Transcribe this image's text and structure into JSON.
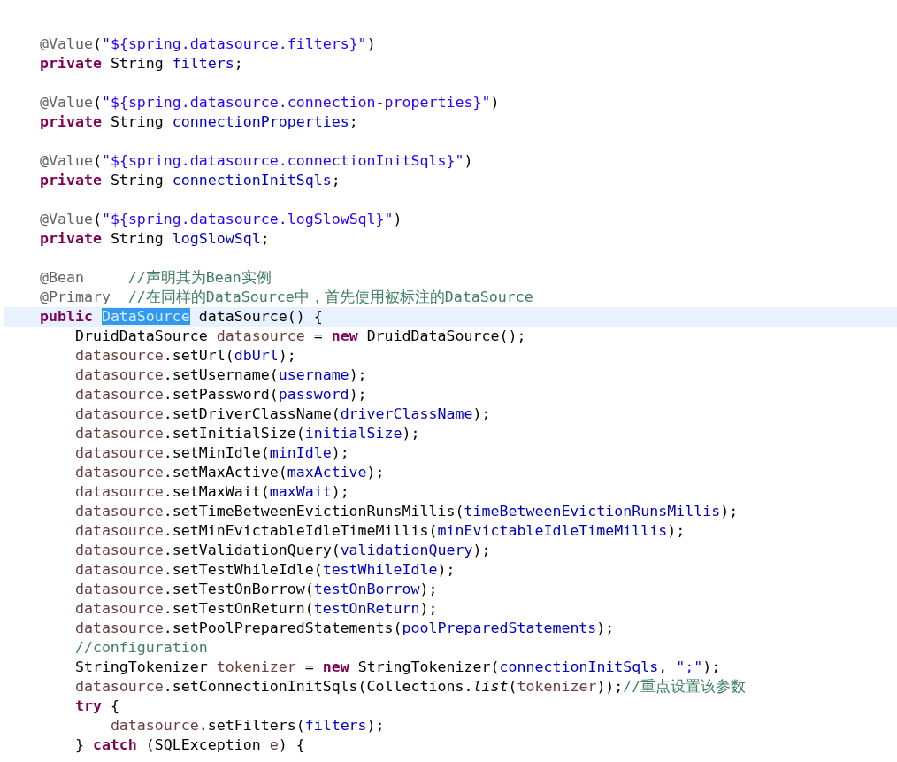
{
  "editor": {
    "lines": [
      {
        "kind": "code",
        "current": false,
        "tokens": [
          {
            "kind": "ann",
            "t": "@Value"
          },
          {
            "kind": "plain",
            "t": "("
          },
          {
            "kind": "str",
            "t": "\"${spring.datasource.filters}\""
          },
          {
            "kind": "plain",
            "t": ")"
          }
        ]
      },
      {
        "kind": "code",
        "current": false,
        "tokens": [
          {
            "kind": "kw",
            "t": "private"
          },
          {
            "kind": "plain",
            "t": " String "
          },
          {
            "kind": "field",
            "t": "filters"
          },
          {
            "kind": "plain",
            "t": ";"
          }
        ]
      },
      {
        "kind": "blank"
      },
      {
        "kind": "code",
        "current": false,
        "tokens": [
          {
            "kind": "ann",
            "t": "@Value"
          },
          {
            "kind": "plain",
            "t": "("
          },
          {
            "kind": "str",
            "t": "\"${spring.datasource.connection-properties}\""
          },
          {
            "kind": "plain",
            "t": ")"
          }
        ]
      },
      {
        "kind": "code",
        "current": false,
        "tokens": [
          {
            "kind": "kw",
            "t": "private"
          },
          {
            "kind": "plain",
            "t": " String "
          },
          {
            "kind": "field",
            "t": "connectionProperties"
          },
          {
            "kind": "plain",
            "t": ";"
          }
        ]
      },
      {
        "kind": "blank"
      },
      {
        "kind": "code",
        "current": false,
        "tokens": [
          {
            "kind": "ann",
            "t": "@Value"
          },
          {
            "kind": "plain",
            "t": "("
          },
          {
            "kind": "str",
            "t": "\"${spring.datasource.connectionInitSqls}\""
          },
          {
            "kind": "plain",
            "t": ")"
          }
        ]
      },
      {
        "kind": "code",
        "current": false,
        "tokens": [
          {
            "kind": "kw",
            "t": "private"
          },
          {
            "kind": "plain",
            "t": " String "
          },
          {
            "kind": "field",
            "t": "connectionInitSqls"
          },
          {
            "kind": "plain",
            "t": ";"
          }
        ]
      },
      {
        "kind": "blank"
      },
      {
        "kind": "code",
        "current": false,
        "tokens": [
          {
            "kind": "ann",
            "t": "@Value"
          },
          {
            "kind": "plain",
            "t": "("
          },
          {
            "kind": "str",
            "t": "\"${spring.datasource.logSlowSql}\""
          },
          {
            "kind": "plain",
            "t": ")"
          }
        ]
      },
      {
        "kind": "code",
        "current": false,
        "tokens": [
          {
            "kind": "kw",
            "t": "private"
          },
          {
            "kind": "plain",
            "t": " String "
          },
          {
            "kind": "field",
            "t": "logSlowSql"
          },
          {
            "kind": "plain",
            "t": ";"
          }
        ]
      },
      {
        "kind": "blank"
      },
      {
        "kind": "code",
        "current": false,
        "tokens": [
          {
            "kind": "ann",
            "t": "@Bean"
          },
          {
            "kind": "comment",
            "t": "//声明其为Bean实例"
          }
        ]
      },
      {
        "kind": "code",
        "current": false,
        "tokens": [
          {
            "kind": "ann",
            "t": "@Primary"
          },
          {
            "kind": "comment",
            "t": "//在同样的DataSource中，首先使用被标注的DataSource"
          }
        ]
      },
      {
        "kind": "code",
        "current": true,
        "tokens": [
          {
            "kind": "kw",
            "t": "public"
          },
          {
            "kind": "sel",
            "t": "DataSource"
          },
          {
            "kind": "plain",
            "t": " dataSource() {"
          }
        ],
        "children": [
          {
            "kind": "code",
            "current": false,
            "tokens": [
              {
                "kind": "plain",
                "t": "DruidDataSource "
              },
              {
                "kind": "local",
                "t": "datasource"
              },
              {
                "kind": "plain",
                "t": " = "
              },
              {
                "kind": "kw",
                "t": "new"
              },
              {
                "kind": "plain",
                "t": " DruidDataSource();"
              }
            ]
          },
          {
            "kind": "code",
            "current": false,
            "tokens": [
              {
                "kind": "local",
                "t": "datasource"
              },
              {
                "kind": "plain",
                "t": ".setUrl("
              },
              {
                "kind": "field",
                "t": "dbUrl"
              },
              {
                "kind": "plain",
                "t": ");"
              }
            ]
          },
          {
            "kind": "code",
            "current": false,
            "tokens": [
              {
                "kind": "local",
                "t": "datasource"
              },
              {
                "kind": "plain",
                "t": ".setUsername("
              },
              {
                "kind": "field",
                "t": "username"
              },
              {
                "kind": "plain",
                "t": ");"
              }
            ]
          },
          {
            "kind": "code",
            "current": false,
            "tokens": [
              {
                "kind": "local",
                "t": "datasource"
              },
              {
                "kind": "plain",
                "t": ".setPassword("
              },
              {
                "kind": "field",
                "t": "password"
              },
              {
                "kind": "plain",
                "t": ");"
              }
            ]
          },
          {
            "kind": "code",
            "current": false,
            "tokens": [
              {
                "kind": "local",
                "t": "datasource"
              },
              {
                "kind": "plain",
                "t": ".setDriverClassName("
              },
              {
                "kind": "field",
                "t": "driverClassName"
              },
              {
                "kind": "plain",
                "t": ");"
              }
            ]
          },
          {
            "kind": "code",
            "current": false,
            "tokens": [
              {
                "kind": "local",
                "t": "datasource"
              },
              {
                "kind": "plain",
                "t": ".setInitialSize("
              },
              {
                "kind": "field",
                "t": "initialSize"
              },
              {
                "kind": "plain",
                "t": ");"
              }
            ]
          },
          {
            "kind": "code",
            "current": false,
            "tokens": [
              {
                "kind": "local",
                "t": "datasource"
              },
              {
                "kind": "plain",
                "t": ".setMinIdle("
              },
              {
                "kind": "field",
                "t": "minIdle"
              },
              {
                "kind": "plain",
                "t": ");"
              }
            ]
          },
          {
            "kind": "code",
            "current": false,
            "tokens": [
              {
                "kind": "local",
                "t": "datasource"
              },
              {
                "kind": "plain",
                "t": ".setMaxActive("
              },
              {
                "kind": "field",
                "t": "maxActive"
              },
              {
                "kind": "plain",
                "t": ");"
              }
            ]
          },
          {
            "kind": "code",
            "current": false,
            "tokens": [
              {
                "kind": "local",
                "t": "datasource"
              },
              {
                "kind": "plain",
                "t": ".setMaxWait("
              },
              {
                "kind": "field",
                "t": "maxWait"
              },
              {
                "kind": "plain",
                "t": ");"
              }
            ]
          },
          {
            "kind": "code",
            "current": false,
            "tokens": [
              {
                "kind": "local",
                "t": "datasource"
              },
              {
                "kind": "plain",
                "t": ".setTimeBetweenEvictionRunsMillis("
              },
              {
                "kind": "field",
                "t": "timeBetweenEvictionRunsMillis"
              },
              {
                "kind": "plain",
                "t": ");"
              }
            ]
          },
          {
            "kind": "code",
            "current": false,
            "tokens": [
              {
                "kind": "local",
                "t": "datasource"
              },
              {
                "kind": "plain",
                "t": ".setMinEvictableIdleTimeMillis("
              },
              {
                "kind": "field",
                "t": "minEvictableIdleTimeMillis"
              },
              {
                "kind": "plain",
                "t": ");"
              }
            ]
          },
          {
            "kind": "code",
            "current": false,
            "tokens": [
              {
                "kind": "local",
                "t": "datasource"
              },
              {
                "kind": "plain",
                "t": ".setValidationQuery("
              },
              {
                "kind": "field",
                "t": "validationQuery"
              },
              {
                "kind": "plain",
                "t": ");"
              }
            ]
          },
          {
            "kind": "code",
            "current": false,
            "tokens": [
              {
                "kind": "local",
                "t": "datasource"
              },
              {
                "kind": "plain",
                "t": ".setTestWhileIdle("
              },
              {
                "kind": "field",
                "t": "testWhileIdle"
              },
              {
                "kind": "plain",
                "t": ");"
              }
            ]
          },
          {
            "kind": "code",
            "current": false,
            "tokens": [
              {
                "kind": "local",
                "t": "datasource"
              },
              {
                "kind": "plain",
                "t": ".setTestOnBorrow("
              },
              {
                "kind": "field",
                "t": "testOnBorrow"
              },
              {
                "kind": "plain",
                "t": ");"
              }
            ]
          },
          {
            "kind": "code",
            "current": false,
            "tokens": [
              {
                "kind": "local",
                "t": "datasource"
              },
              {
                "kind": "plain",
                "t": ".setTestOnReturn("
              },
              {
                "kind": "field",
                "t": "testOnReturn"
              },
              {
                "kind": "plain",
                "t": ");"
              }
            ]
          },
          {
            "kind": "code",
            "current": false,
            "tokens": [
              {
                "kind": "local",
                "t": "datasource"
              },
              {
                "kind": "plain",
                "t": ".setPoolPreparedStatements("
              },
              {
                "kind": "field",
                "t": "poolPreparedStatements"
              },
              {
                "kind": "plain",
                "t": ");"
              }
            ]
          },
          {
            "kind": "code",
            "current": false,
            "tokens": [
              {
                "kind": "comment",
                "t": "//configuration"
              }
            ]
          },
          {
            "kind": "code",
            "current": false,
            "tokens": [
              {
                "kind": "plain",
                "t": "StringTokenizer "
              },
              {
                "kind": "local",
                "t": "tokenizer"
              },
              {
                "kind": "plain",
                "t": " = "
              },
              {
                "kind": "kw",
                "t": "new"
              },
              {
                "kind": "plain",
                "t": " StringTokenizer("
              },
              {
                "kind": "field",
                "t": "connectionInitSqls"
              },
              {
                "kind": "plain",
                "t": ", "
              },
              {
                "kind": "str",
                "t": "\";\""
              },
              {
                "kind": "plain",
                "t": ");"
              }
            ]
          },
          {
            "kind": "code",
            "current": false,
            "tokens": [
              {
                "kind": "local",
                "t": "datasource"
              },
              {
                "kind": "plain",
                "t": ".setConnectionInitSqls(Collections."
              },
              {
                "kind": "static",
                "t": "list"
              },
              {
                "kind": "plain",
                "t": "("
              },
              {
                "kind": "local",
                "t": "tokenizer"
              },
              {
                "kind": "plain",
                "t": "));"
              },
              {
                "kind": "comment",
                "t": "//重点设置该参数"
              }
            ]
          },
          {
            "kind": "code",
            "current": false,
            "tokens": [
              {
                "kind": "kw",
                "t": "try"
              },
              {
                "kind": "plain",
                "t": " {"
              }
            ],
            "children": [
              {
                "kind": "code",
                "current": false,
                "tokens": [
                  {
                    "kind": "local",
                    "t": "datasource"
                  },
                  {
                    "kind": "plain",
                    "t": ".setFilters("
                  },
                  {
                    "kind": "field",
                    "t": "filters"
                  },
                  {
                    "kind": "plain",
                    "t": ");"
                  }
                ]
              }
            ]
          },
          {
            "kind": "code",
            "current": false,
            "tokens": [
              {
                "kind": "plain",
                "t": "} "
              },
              {
                "kind": "kw",
                "t": "catch"
              },
              {
                "kind": "plain",
                "t": " (SQLException "
              },
              {
                "kind": "local",
                "t": "e"
              },
              {
                "kind": "plain",
                "t": ") {"
              }
            ]
          }
        ]
      }
    ]
  }
}
